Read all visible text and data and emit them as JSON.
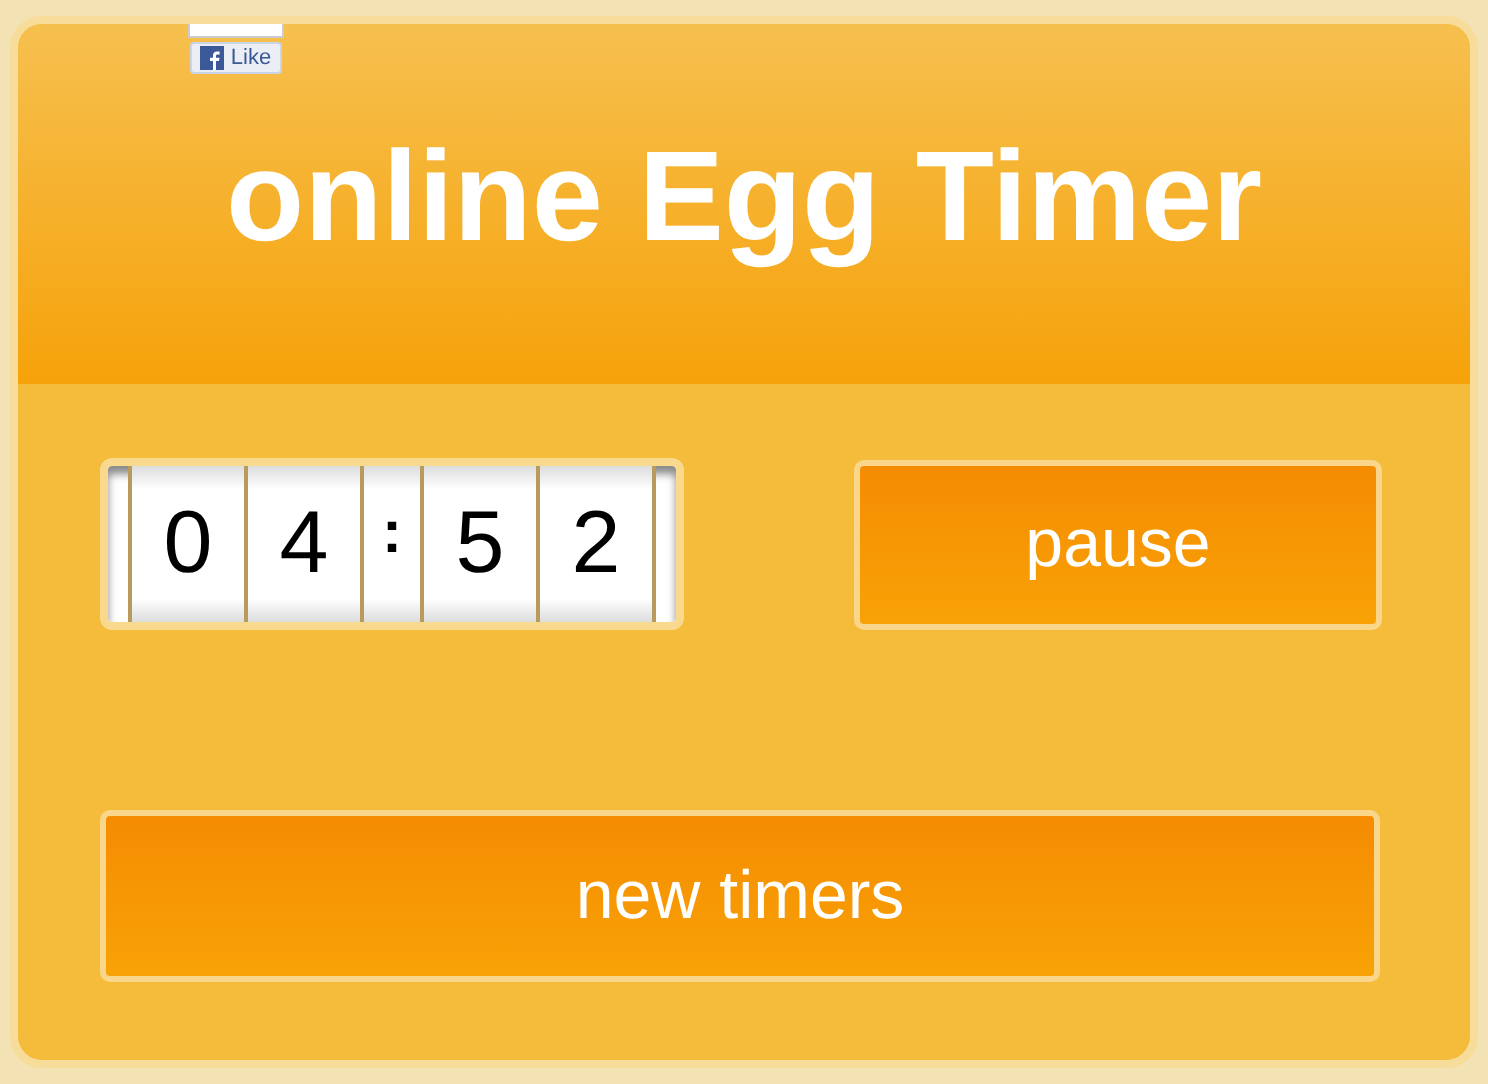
{
  "like_button": {
    "label": "Like"
  },
  "title": "online Egg Timer",
  "timer_display": {
    "cells": [
      {
        "kind": "digit",
        "text": "0"
      },
      {
        "kind": "digit",
        "text": "4"
      },
      {
        "kind": "separator",
        "text": ":"
      },
      {
        "kind": "digit",
        "text": "5"
      },
      {
        "kind": "digit",
        "text": "2"
      }
    ]
  },
  "pause_button": {
    "label": "pause"
  },
  "new_timers_button": {
    "label": "new timers"
  }
}
